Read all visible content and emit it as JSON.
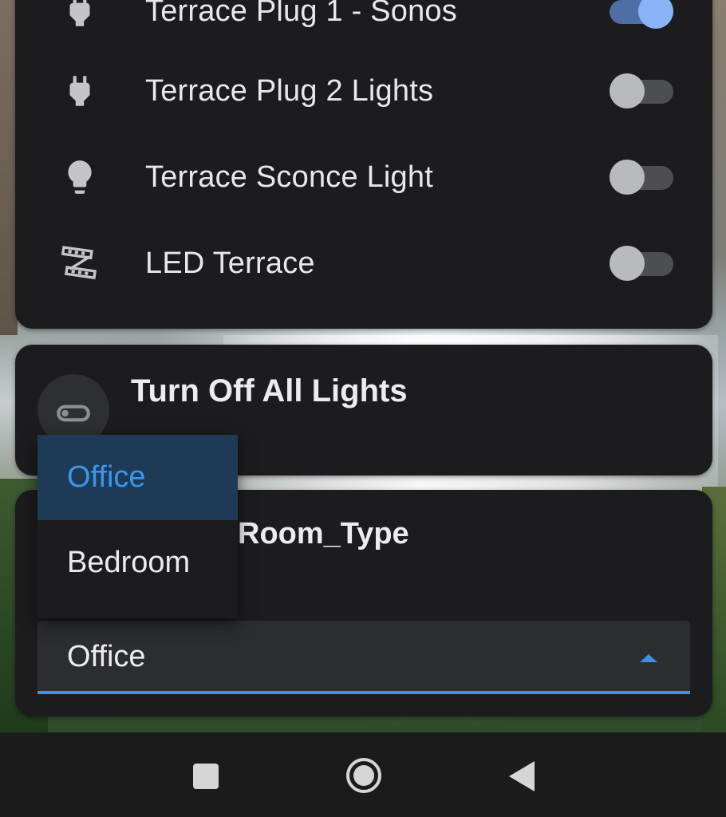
{
  "entities_card": {
    "rows": [
      {
        "label": "Terrace Plug 1 - Sonos",
        "icon": "power-plug-icon",
        "state": "on"
      },
      {
        "label": "Terrace Plug 2 Lights",
        "icon": "power-plug-icon",
        "state": "off"
      },
      {
        "label": "Terrace Sconce Light",
        "icon": "lightbulb-icon",
        "state": "off"
      },
      {
        "label": "LED Terrace",
        "icon": "led-strip-icon",
        "state": "off"
      }
    ]
  },
  "script_card": {
    "title": "Turn Off All Lights",
    "icon": "toggle-switch-off-icon"
  },
  "room_card": {
    "title": "Room_Type",
    "select_value": "Office"
  },
  "dropdown": {
    "options": [
      {
        "label": "Office",
        "selected": true
      },
      {
        "label": "Bedroom",
        "selected": false
      }
    ]
  },
  "nav": {
    "icons": [
      "recents-square-icon",
      "home-circle-icon",
      "back-triangle-icon"
    ]
  },
  "colors": {
    "accent": "#3a92e0",
    "toggle_on": "#8ab4f8",
    "card_bg": "#1c1c1f",
    "selected_option_bg": "#1e3a57"
  }
}
